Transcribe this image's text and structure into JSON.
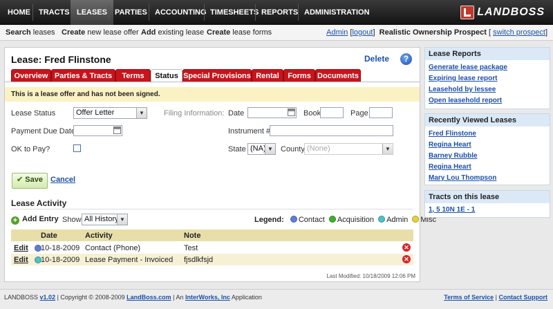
{
  "nav": {
    "items": [
      "HOME",
      "TRACTS",
      "LEASES",
      "PARTIES",
      "ACCOUNTING",
      "TIMESHEETS",
      "REPORTS",
      "ADMINISTRATION"
    ],
    "active": "LEASES",
    "logo_text": "LANDBOSS"
  },
  "subnav": {
    "links": [
      {
        "bold": "Search",
        "rest": " leases"
      },
      {
        "bold": "Create",
        "rest": " new lease offer"
      },
      {
        "bold": "Add",
        "rest": " existing lease"
      },
      {
        "bold": "Create",
        "rest": " lease forms"
      }
    ],
    "user": "Admin",
    "logout": "logout",
    "company": "Realistic Ownership Prospect",
    "switch": "switch prospect"
  },
  "lease": {
    "title": "Lease: Fred Flinstone",
    "delete": "Delete",
    "help": "?"
  },
  "tabs": [
    "Overview",
    "Parties & Tracts",
    "Terms",
    "Status",
    "Special Provisions",
    "Rental",
    "Forms",
    "Documents"
  ],
  "active_tab": "Status",
  "notice": "This is a lease offer and has not been signed.",
  "form": {
    "lease_status_label": "Lease Status",
    "lease_status_value": "Offer Letter",
    "payment_due_label": "Payment Due Date",
    "ok_to_pay_label": "OK to Pay?",
    "filing_label": "Filing Information:",
    "date_label": "Date",
    "book_label": "Book",
    "page_label": "Page",
    "instrument_label": "Instrument #",
    "state_label": "State",
    "state_value": "(NA)",
    "county_label": "County",
    "county_value": "(None)"
  },
  "actions": {
    "save": "Save",
    "cancel": "Cancel"
  },
  "activity": {
    "heading": "Lease Activity",
    "add_entry": "Add Entry",
    "show_label": "Show",
    "show_value": "All History",
    "legend_label": "Legend:",
    "legend": [
      {
        "name": "Contact",
        "color": "#5c7fd8"
      },
      {
        "name": "Acquisition",
        "color": "#3fae2f"
      },
      {
        "name": "Admin",
        "color": "#4ec1c8"
      },
      {
        "name": "Misc",
        "color": "#e6d23a"
      }
    ],
    "columns": [
      "Date",
      "Activity",
      "Note"
    ],
    "rows": [
      {
        "edit": "Edit",
        "date": "10-18-2009",
        "activity": "Contact (Phone)",
        "note": "Test",
        "color": "#5c7fd8"
      },
      {
        "edit": "Edit",
        "date": "10-18-2009",
        "activity": "Lease Payment - Invoiced",
        "note": "fjsdlkfsjd",
        "color": "#4ec1c8"
      }
    ],
    "last_modified": "Last Modified: 10/18/2009 12:06 PM"
  },
  "sidebar": {
    "reports_title": "Lease Reports",
    "reports": [
      "Generate lease package",
      "Expiring lease report",
      "Leasehold by lessee",
      "Open leasehold report"
    ],
    "recent_title": "Recently Viewed Leases",
    "recent": [
      "Fred Flinstone",
      "Regina Heart",
      "Barney Rubble",
      "Regina Heart",
      "Mary Lou Thompson"
    ],
    "tracts_title": "Tracts on this lease",
    "tracts": [
      "1, 5 10N 1E - 1"
    ]
  },
  "footer": {
    "brand": "LANDBOSS",
    "version": "v1.02",
    "copyright": " | Copyright © 2008-2009 ",
    "site": "LandBoss.com",
    "an": " | An ",
    "company": "InterWorks, Inc",
    "app": " Application",
    "terms": "Terms of Service",
    "support": "Contact Support"
  }
}
